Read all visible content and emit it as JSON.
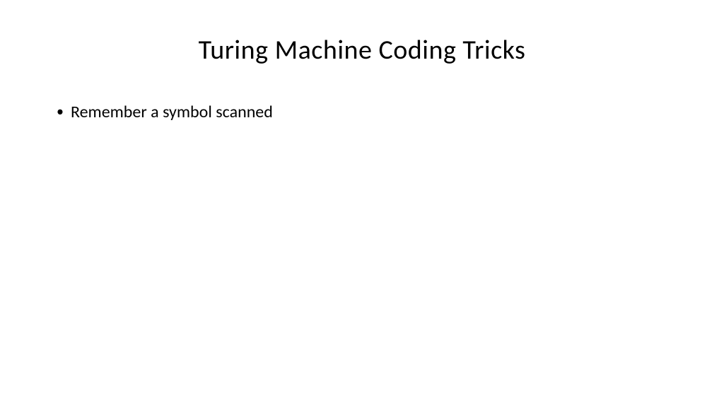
{
  "slide": {
    "title": "Turing Machine Coding Tricks",
    "bullets": [
      "Remember a symbol scanned"
    ]
  }
}
